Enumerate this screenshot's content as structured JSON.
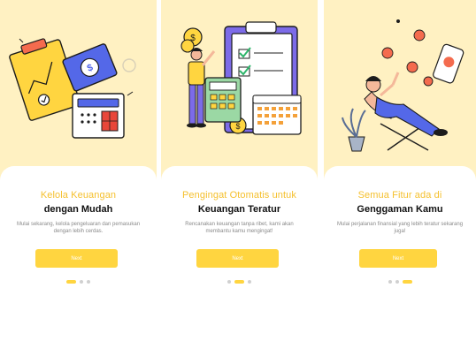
{
  "screens": [
    {
      "title_line1": "Kelola Keuangan",
      "title_line2": "dengan Mudah",
      "description": "Mulai sekarang, kelola pengeluaran dan pemasukan dengan lebih cerdas.",
      "button_label": "Next",
      "active_dot": 0
    },
    {
      "title_line1": "Pengingat Otomatis untuk",
      "title_line2": "Keuangan Teratur",
      "description": "Rencanakan keuangan tanpa ribet, kami akan membantu kamu mengingat!",
      "button_label": "Next",
      "active_dot": 1
    },
    {
      "title_line1": "Semua Fitur ada di",
      "title_line2": "Genggaman Kamu",
      "description": "Mulai perjalanan finansial yang lebih teratur sekarang juga!",
      "button_label": "Next",
      "active_dot": 2
    }
  ],
  "icons": {
    "screen1": "finance-documents-illustration",
    "screen2": "checklist-calendar-illustration",
    "screen3": "relaxing-person-illustration"
  },
  "colors": {
    "background": "#FFF1C2",
    "accent": "#FFD540",
    "title_accent": "#F5C02E",
    "inactive_dot": "#D0D0D0"
  }
}
